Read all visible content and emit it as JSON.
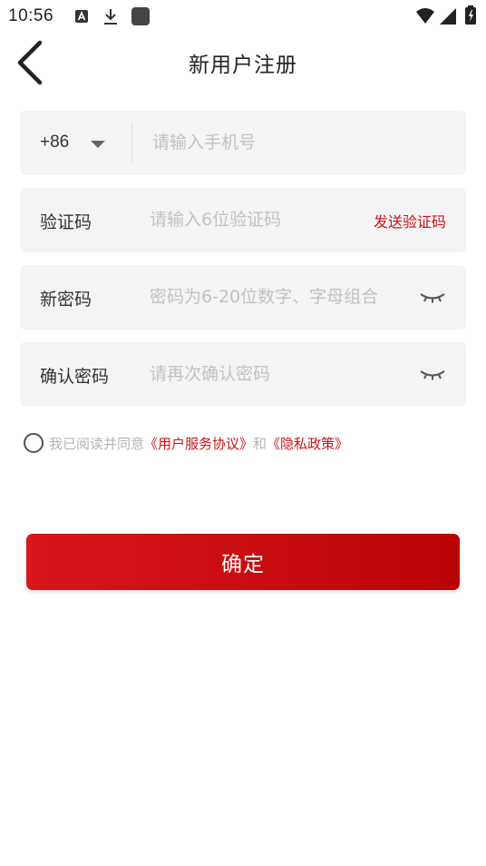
{
  "status_bar": {
    "time": "10:56",
    "left_icons": [
      "a-icon",
      "download-icon",
      "app-square-icon"
    ],
    "right_icons": [
      "wifi-icon",
      "cellular-signal-icon",
      "battery-charging-icon"
    ]
  },
  "header": {
    "back_icon": "chevron-left-icon",
    "title": "新用户注册"
  },
  "form": {
    "phone": {
      "country_code": "+86",
      "placeholder": "请输入手机号"
    },
    "code": {
      "label": "验证码",
      "placeholder": "请输入6位验证码",
      "send_label": "发送验证码"
    },
    "password": {
      "label": "新密码",
      "placeholder": "密码为6-20位数字、字母组合",
      "eye_icon": "eye-closed-icon"
    },
    "confirm_password": {
      "label": "确认密码",
      "placeholder": "请再次确认密码",
      "eye_icon": "eye-closed-icon"
    }
  },
  "agreement": {
    "checked": false,
    "prefix": "我已阅读并同意",
    "user_agreement": "《用户服务协议》",
    "conjunction": "和",
    "privacy_policy": "《隐私政策》"
  },
  "submit": {
    "label": "确定"
  },
  "colors": {
    "accent": "#c8141a",
    "field_bg": "#f4f4f4",
    "placeholder": "#c2c2c2"
  }
}
